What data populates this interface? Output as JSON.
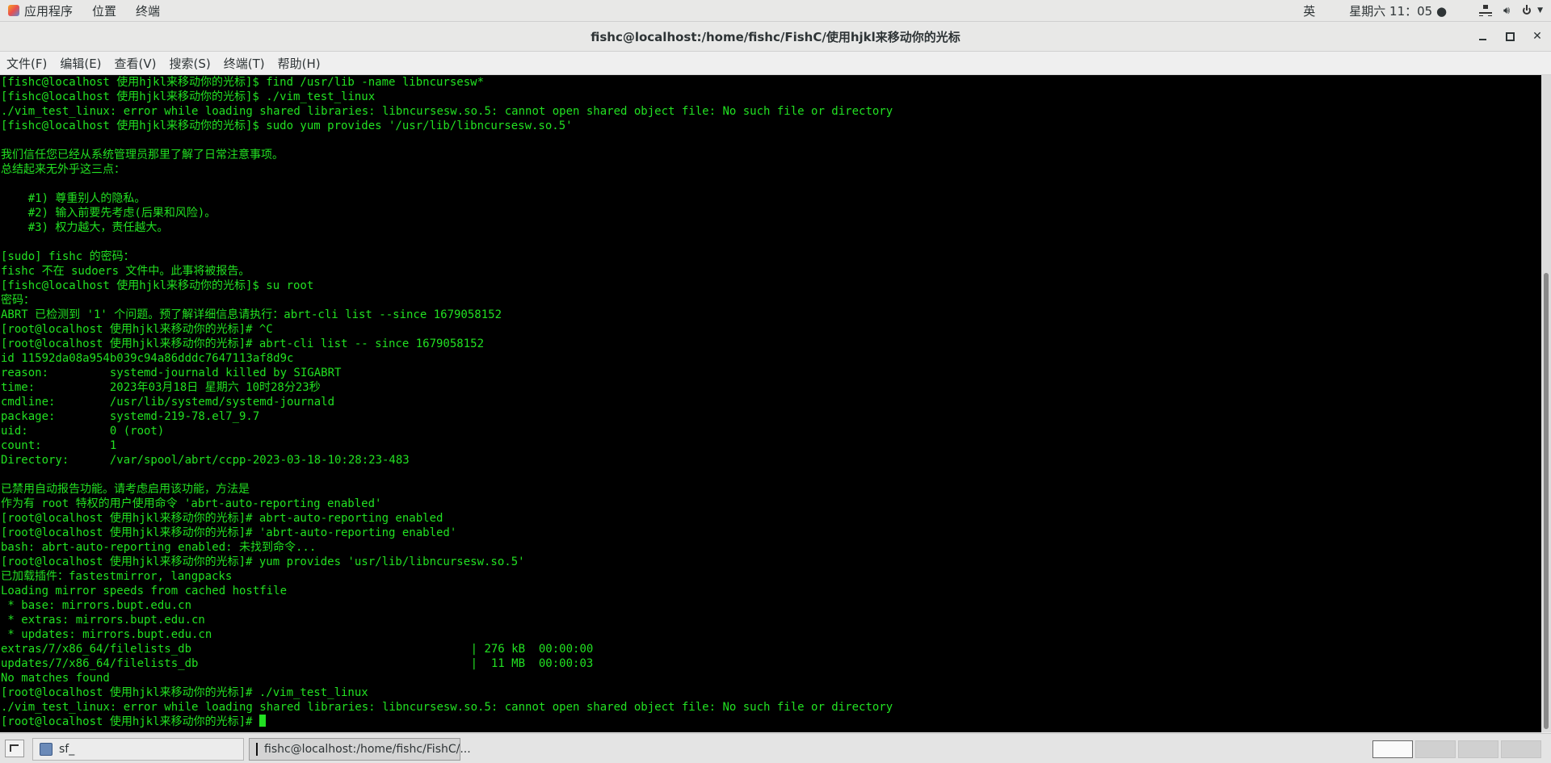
{
  "top_panel": {
    "apps_label": "应用程序",
    "places_label": "位置",
    "terminal_label": "终端",
    "ime": "英",
    "clock": "星期六 11：05 ●"
  },
  "window": {
    "title": "fishc@localhost:/home/fishc/FishC/使用hjkl来移动你的光标"
  },
  "menu": {
    "file": "文件(F)",
    "edit": "编辑(E)",
    "view": "查看(V)",
    "search": "搜索(S)",
    "terminal": "终端(T)",
    "help": "帮助(H)"
  },
  "terminal": {
    "lines": [
      "[fishc@localhost 使用hjkl来移动你的光标]$ find /usr/lib -name libncursesw*",
      "[fishc@localhost 使用hjkl来移动你的光标]$ ./vim_test_linux",
      "./vim_test_linux: error while loading shared libraries: libncursesw.so.5: cannot open shared object file: No such file or directory",
      "[fishc@localhost 使用hjkl来移动你的光标]$ sudo yum provides '/usr/lib/libncursesw.so.5'",
      "",
      "我们信任您已经从系统管理员那里了解了日常注意事项。",
      "总结起来无外乎这三点：",
      "",
      "    #1) 尊重别人的隐私。",
      "    #2) 输入前要先考虑(后果和风险)。",
      "    #3) 权力越大，责任越大。",
      "",
      "[sudo] fishc 的密码：",
      "fishc 不在 sudoers 文件中。此事将被报告。",
      "[fishc@localhost 使用hjkl来移动你的光标]$ su root",
      "密码：",
      "ABRT 已检测到 '1' 个问题。预了解详细信息请执行：abrt-cli list --since 1679058152",
      "[root@localhost 使用hjkl来移动你的光标]# ^C",
      "[root@localhost 使用hjkl来移动你的光标]# abrt-cli list -- since 1679058152",
      "id 11592da08a954b039c94a86dddc7647113af8d9c",
      "reason:         systemd-journald killed by SIGABRT",
      "time:           2023年03月18日 星期六 10时28分23秒",
      "cmdline:        /usr/lib/systemd/systemd-journald",
      "package:        systemd-219-78.el7_9.7",
      "uid:            0 (root)",
      "count:          1",
      "Directory:      /var/spool/abrt/ccpp-2023-03-18-10:28:23-483",
      "",
      "已禁用自动报告功能。请考虑启用该功能，方法是",
      "作为有 root 特权的用户使用命令 'abrt-auto-reporting enabled'",
      "[root@localhost 使用hjkl来移动你的光标]# abrt-auto-reporting enabled",
      "[root@localhost 使用hjkl来移动你的光标]# 'abrt-auto-reporting enabled'",
      "bash: abrt-auto-reporting enabled: 未找到命令...",
      "[root@localhost 使用hjkl来移动你的光标]# yum provides 'usr/lib/libncursesw.so.5'",
      "已加载插件：fastestmirror, langpacks",
      "Loading mirror speeds from cached hostfile",
      " * base: mirrors.bupt.edu.cn",
      " * extras: mirrors.bupt.edu.cn",
      " * updates: mirrors.bupt.edu.cn",
      "extras/7/x86_64/filelists_db                                         | 276 kB  00:00:00",
      "updates/7/x86_64/filelists_db                                        |  11 MB  00:00:03",
      "No matches found",
      "[root@localhost 使用hjkl来移动你的光标]# ./vim_test_linux",
      "./vim_test_linux: error while loading shared libraries: libncursesw.so.5: cannot open shared object file: No such file or directory"
    ],
    "prompt": "[root@localhost 使用hjkl来移动你的光标]# "
  },
  "taskbar": {
    "task1": "sf_",
    "task2": "fishc@localhost:/home/fishc/FishC/..."
  },
  "colors": {
    "terminal_bg": "#000000",
    "terminal_fg": "#22e022"
  }
}
